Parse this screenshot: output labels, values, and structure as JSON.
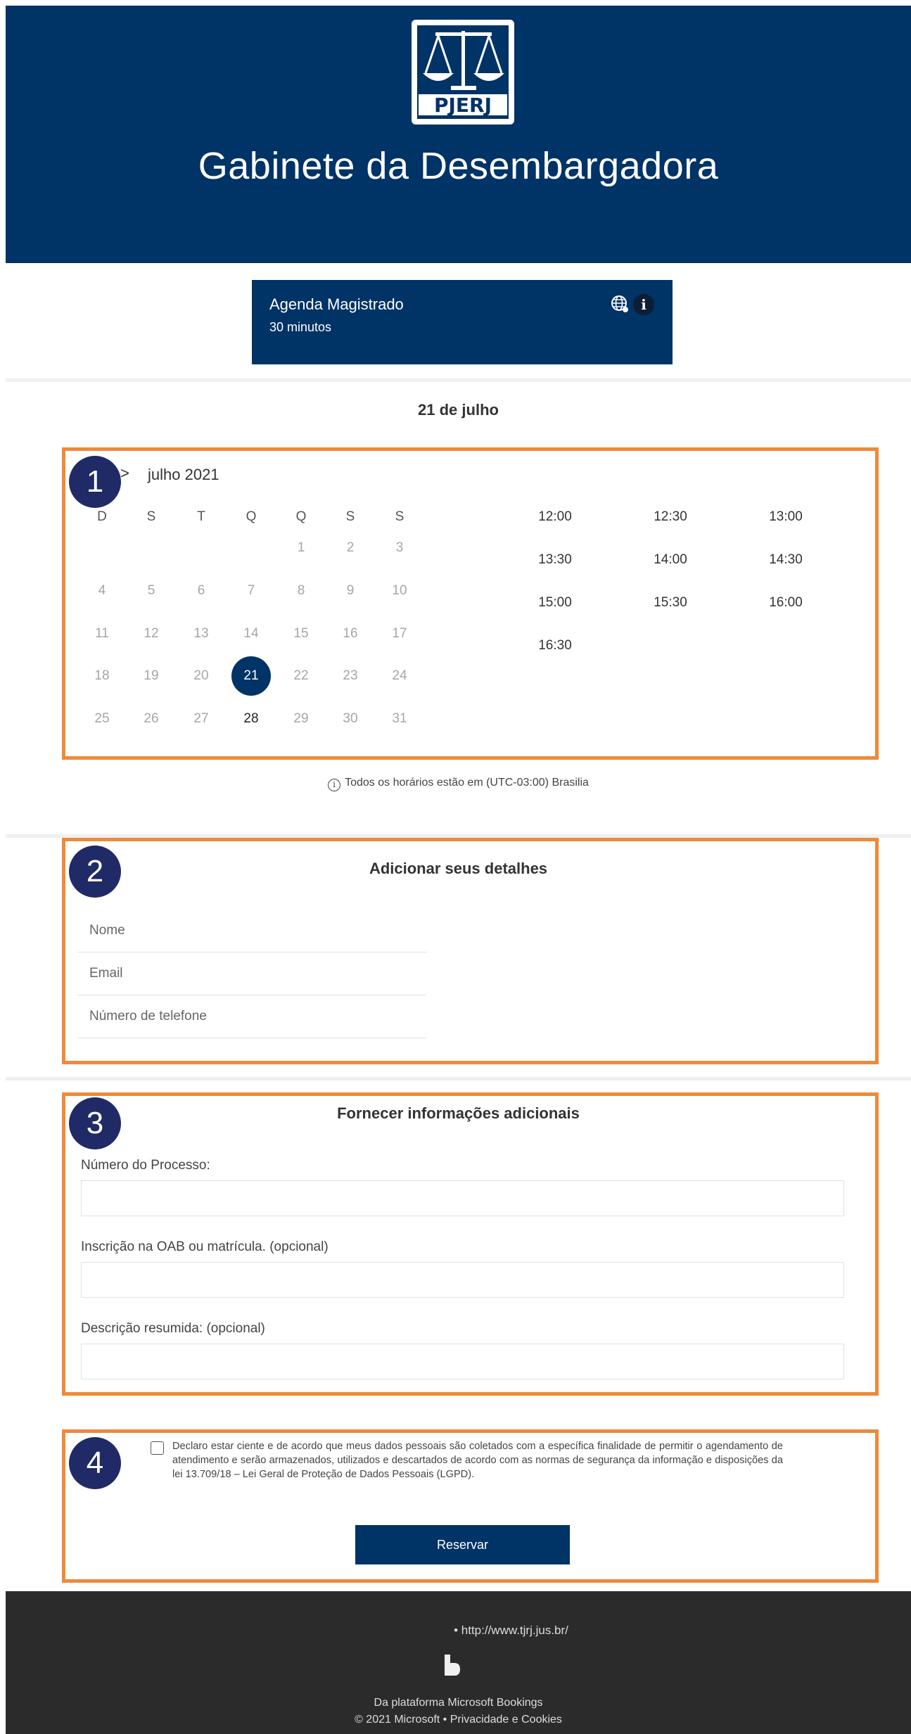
{
  "header": {
    "logo_text": "PJERJ",
    "title": "Gabinete da Desembargadora"
  },
  "service": {
    "name": "Agenda Magistrado",
    "duration": "30 minutos",
    "info_glyph": "i",
    "globe_icon": "globe-icon"
  },
  "selected_date": "21 de julho",
  "calendar": {
    "next_glyph": ">",
    "month_label": "julho 2021",
    "weekdays": [
      "D",
      "S",
      "T",
      "Q",
      "Q",
      "S",
      "S"
    ],
    "weeks": [
      [
        "",
        "",
        "",
        "",
        "1",
        "2",
        "3"
      ],
      [
        "4",
        "5",
        "6",
        "7",
        "8",
        "9",
        "10"
      ],
      [
        "11",
        "12",
        "13",
        "14",
        "15",
        "16",
        "17"
      ],
      [
        "18",
        "19",
        "20",
        "21",
        "22",
        "23",
        "24"
      ],
      [
        "25",
        "26",
        "27",
        "28",
        "29",
        "30",
        "31"
      ]
    ],
    "selected_day": "21",
    "available_days": [
      "21",
      "28"
    ]
  },
  "time_slots": [
    "12:00",
    "12:30",
    "13:00",
    "13:30",
    "14:00",
    "14:30",
    "15:00",
    "15:30",
    "16:00",
    "16:30"
  ],
  "timezone_note": "Todos os horários estão em (UTC-03:00) Brasilia",
  "details": {
    "title": "Adicionar seus detalhes",
    "name_placeholder": "Nome",
    "email_placeholder": "Email",
    "phone_placeholder": "Número de telefone"
  },
  "additional": {
    "title": "Fornecer informações adicionais",
    "q1_label": "Número do Processo:",
    "q2_label": "Inscrição na OAB ou matrícula. (opcional)",
    "q3_label": "Descrição resumida: (opcional)"
  },
  "consent": {
    "text": "Declaro estar ciente e de acordo que meus dados pessoais são coletados com a específica finalidade de permitir o agendamento de atendimento e serão armazenados, utilizados e descartados de acordo com as normas de segurança da informação e disposições da lei 13.709/18 – Lei Geral de Proteção de Dados Pessoais (LGPD).",
    "checked": false
  },
  "reserve_label": "Reservar",
  "annotations": [
    "1",
    "2",
    "3",
    "4"
  ],
  "footer": {
    "link": "• http://www.tjrj.jus.br/",
    "platform": "Da plataforma Microsoft Bookings",
    "copyright": "© 2021 Microsoft • Privacidade e Cookies"
  },
  "colors": {
    "brand_navy": "#003366",
    "highlight_orange": "#ee8a3a",
    "badge_navy": "#1f2a66",
    "footer_bg": "#2b2b2b"
  }
}
